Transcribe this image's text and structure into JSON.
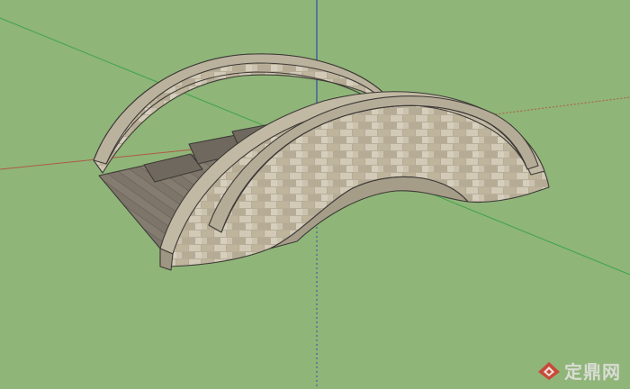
{
  "scene": {
    "background_color": "#8fb579",
    "axis_colors": {
      "red": "#b05a46",
      "green": "#3fa34a",
      "blue": "#2d4ea6"
    },
    "model": {
      "subject": "stone-arch-bridge",
      "stone_color": "#c8bfa9",
      "deck_color": "#7c7469",
      "edge_color": "#3d3a36"
    }
  },
  "watermark": {
    "text": "定鼎网",
    "logo_icon": "dingding-logo-icon",
    "logo_color": "#c94a3a"
  }
}
